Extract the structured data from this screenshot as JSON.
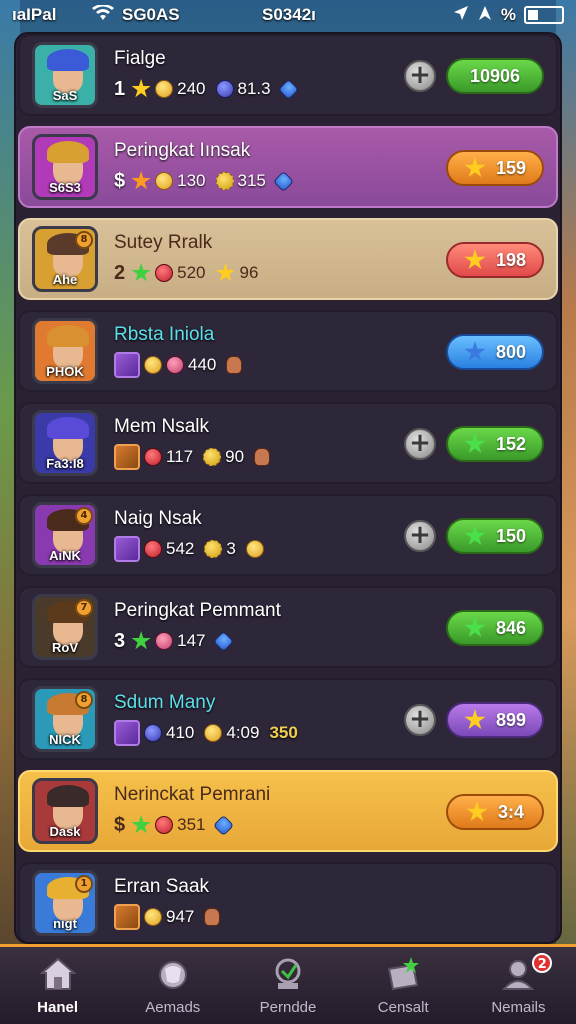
{
  "status_bar": {
    "carrier": "ıaIPal",
    "network": "SG0AS",
    "time": "S0342ı",
    "battery_pct": "%"
  },
  "rows": [
    {
      "name": "Fialge",
      "name_color": "white",
      "style": "plain",
      "rank": "1",
      "rank_icon": "star-yellow",
      "stats": [
        {
          "icon": "coin",
          "value": "240"
        },
        {
          "icon": "bluecoin",
          "value": "81.3"
        },
        {
          "icon": "gem",
          "value": ""
        }
      ],
      "has_plus": true,
      "score": "10906",
      "score_color": "green",
      "score_star": false,
      "avatar_tag": "SaS",
      "avatar_hair": "#3a5ad8",
      "avatar_bg": "#3ab0a8"
    },
    {
      "name": "Peringkat Iınsak",
      "name_color": "white",
      "style": "violet",
      "rank": "$",
      "rank_icon": "star-orange",
      "stats": [
        {
          "icon": "coin",
          "value": "130"
        },
        {
          "icon": "sun",
          "value": "315"
        },
        {
          "icon": "gem",
          "value": ""
        }
      ],
      "has_plus": false,
      "score": "159",
      "score_color": "orange",
      "score_star": true,
      "avatar_tag": "S6S3",
      "avatar_hair": "#d8a030",
      "avatar_bg": "#b03ab8"
    },
    {
      "name": "Sutey Rralk",
      "name_color": "brown",
      "style": "beige",
      "rank": "2",
      "rank_icon": "star-green",
      "stats": [
        {
          "icon": "heart",
          "value": "520"
        },
        {
          "icon": "star-yellow",
          "value": "96"
        }
      ],
      "has_plus": false,
      "score": "198",
      "score_color": "red",
      "score_star": true,
      "avatar_tag": "Ahe",
      "avatar_hair": "#5a3a2a",
      "avatar_bg": "#d8a030",
      "avatar_badge": "8"
    },
    {
      "name": "Rbsta Iniola",
      "name_color": "cyan",
      "style": "plain",
      "rank": "",
      "rank_icon": "card-purple",
      "stats": [
        {
          "icon": "coin",
          "value": ""
        },
        {
          "icon": "pink",
          "value": "440"
        },
        {
          "icon": "fist",
          "value": ""
        }
      ],
      "has_plus": false,
      "score": "800",
      "score_color": "blue",
      "score_star": true,
      "avatar_tag": "PHOK",
      "avatar_hair": "#d89030",
      "avatar_bg": "#e07a30"
    },
    {
      "name": "Mem Nsalk",
      "name_color": "white",
      "style": "plain",
      "rank": "",
      "rank_icon": "card-orange",
      "stats": [
        {
          "icon": "heart",
          "value": "117"
        },
        {
          "icon": "sun",
          "value": "90"
        },
        {
          "icon": "fist",
          "value": ""
        }
      ],
      "has_plus": true,
      "score": "152",
      "score_color": "green",
      "score_star": true,
      "avatar_tag": "Fa3:I8",
      "avatar_hair": "#5a4ad8",
      "avatar_bg": "#3a3aa8"
    },
    {
      "name": "Naig Nsak",
      "name_color": "white",
      "style": "plain",
      "rank": "",
      "rank_icon": "card-purple",
      "stats": [
        {
          "icon": "heart",
          "value": "542"
        },
        {
          "icon": "sun",
          "value": "3"
        },
        {
          "icon": "coin",
          "value": ""
        }
      ],
      "has_plus": true,
      "score": "150",
      "score_color": "green",
      "score_star": true,
      "avatar_tag": "AıNK",
      "avatar_hair": "#4a2a1a",
      "avatar_bg": "#8a3ab0",
      "avatar_badge": "4"
    },
    {
      "name": "Peringkat Pemmant",
      "name_color": "white",
      "style": "plain",
      "rank": "3",
      "rank_icon": "star-green",
      "stats": [
        {
          "icon": "pink",
          "value": "147"
        },
        {
          "icon": "gem",
          "value": ""
        }
      ],
      "has_plus": false,
      "score": "846",
      "score_color": "green",
      "score_star": true,
      "avatar_tag": "RoV",
      "avatar_hair": "#5a3a1a",
      "avatar_bg": "#4a3a2a",
      "avatar_badge": "7"
    },
    {
      "name": "Sdum Many",
      "name_color": "cyan",
      "style": "plain",
      "rank": "",
      "rank_icon": "card-purple",
      "stats": [
        {
          "icon": "bluecoin",
          "value": "410"
        },
        {
          "icon": "coin",
          "value": "4:09"
        },
        {
          "icon": "none",
          "value": "350",
          "gold": true
        }
      ],
      "has_plus": true,
      "score": "899",
      "score_color": "purple",
      "score_star": true,
      "avatar_tag": "NICK",
      "avatar_hair": "#c87a30",
      "avatar_bg": "#2a9ab8",
      "avatar_badge": "8"
    },
    {
      "name": "Nerinckat Pemrani",
      "name_color": "brown",
      "style": "gold",
      "rank": "$",
      "rank_icon": "star-green",
      "stats": [
        {
          "icon": "heart",
          "value": "351"
        },
        {
          "icon": "gem",
          "value": ""
        }
      ],
      "has_plus": false,
      "score": "3:4",
      "score_color": "orange",
      "score_star": true,
      "avatar_tag": "Dask",
      "avatar_hair": "#3a2a2a",
      "avatar_bg": "#a83a3a"
    },
    {
      "name": "Erran Saak",
      "name_color": "white",
      "style": "plain",
      "rank": "",
      "rank_icon": "card-orange",
      "stats": [
        {
          "icon": "coin",
          "value": "947"
        },
        {
          "icon": "fist",
          "value": ""
        }
      ],
      "has_plus": false,
      "score": "",
      "score_color": "none",
      "score_star": false,
      "avatar_tag": "nıgt",
      "avatar_hair": "#e8b030",
      "avatar_bg": "#3a7ad8",
      "avatar_badge": "1"
    }
  ],
  "tabs": [
    {
      "label": "Hanel",
      "icon": "home-icon",
      "active": true
    },
    {
      "label": "Aemads",
      "icon": "rewards-icon",
      "active": false
    },
    {
      "label": "Perndde",
      "icon": "leaderboard-icon",
      "active": false
    },
    {
      "label": "Censalt",
      "icon": "gift-icon",
      "active": false
    },
    {
      "label": "Nemails",
      "icon": "profile-icon",
      "active": false,
      "notification": "2"
    }
  ]
}
